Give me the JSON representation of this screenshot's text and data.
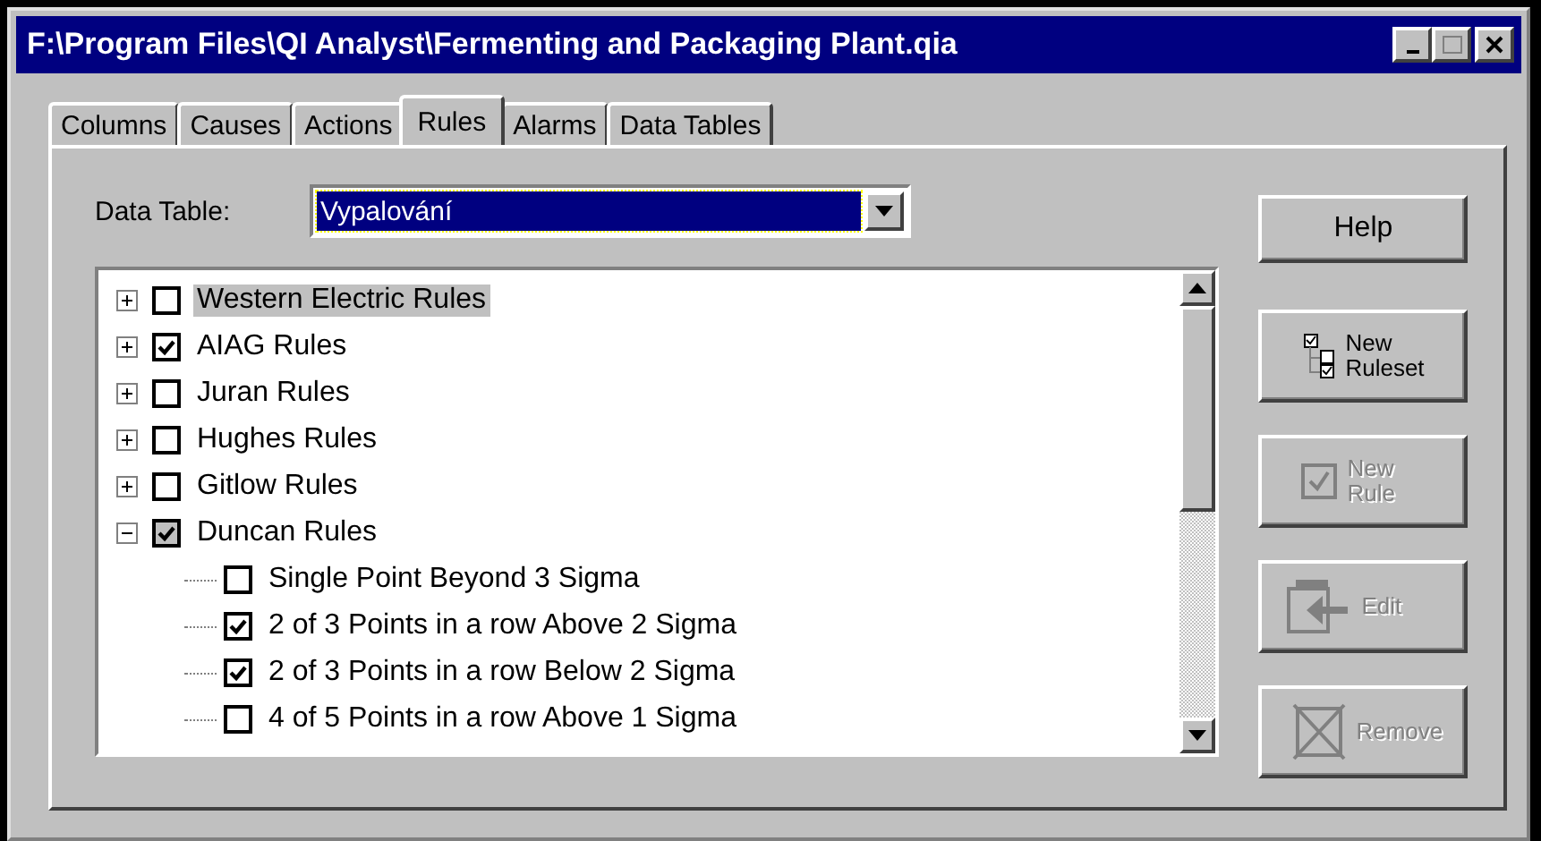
{
  "window": {
    "title": "F:\\Program Files\\QI Analyst\\Fermenting and Packaging Plant.qia"
  },
  "tabs": [
    {
      "label": "Columns",
      "selected": false
    },
    {
      "label": "Causes",
      "selected": false
    },
    {
      "label": "Actions",
      "selected": false
    },
    {
      "label": "Rules",
      "selected": true
    },
    {
      "label": "Alarms",
      "selected": false
    },
    {
      "label": "Data Tables",
      "selected": false
    }
  ],
  "data_table": {
    "label": "Data Table:",
    "value": "Vypalování"
  },
  "tree": [
    {
      "label": "Western Electric Rules",
      "checked": false,
      "selected": true,
      "expanded": false
    },
    {
      "label": "AIAG Rules",
      "checked": true,
      "selected": false,
      "expanded": false
    },
    {
      "label": "Juran Rules",
      "checked": false,
      "selected": false,
      "expanded": false
    },
    {
      "label": "Hughes Rules",
      "checked": false,
      "selected": false,
      "expanded": false
    },
    {
      "label": "Gitlow Rules",
      "checked": false,
      "selected": false,
      "expanded": false
    },
    {
      "label": "Duncan Rules",
      "checked": true,
      "selected": false,
      "expanded": true,
      "children": [
        {
          "label": "Single Point Beyond 3 Sigma",
          "checked": false
        },
        {
          "label": "2 of 3 Points in a row Above 2 Sigma",
          "checked": true
        },
        {
          "label": "2 of 3 Points in a row Below 2 Sigma",
          "checked": true
        },
        {
          "label": "4 of 5 Points in a row Above 1 Sigma",
          "checked": false
        }
      ]
    }
  ],
  "buttons": [
    {
      "kind": "text",
      "label": "Help",
      "disabled": false
    },
    {
      "kind": "ruleset",
      "label": "New Ruleset",
      "disabled": false
    },
    {
      "kind": "rule",
      "label": "New Rule",
      "disabled": true
    },
    {
      "kind": "edit",
      "label": "Edit",
      "disabled": true
    },
    {
      "kind": "remove",
      "label": "Remove",
      "disabled": true
    }
  ]
}
